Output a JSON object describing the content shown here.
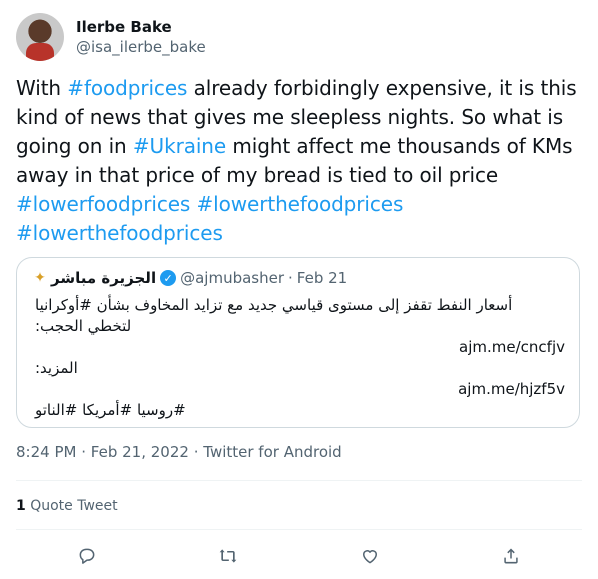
{
  "author": {
    "display_name": "Ilerbe Bake",
    "handle": "@isa_ilerbe_bake"
  },
  "tweet": {
    "segments": [
      {
        "text": "With ",
        "type": "text"
      },
      {
        "text": "#foodprices",
        "type": "hashtag"
      },
      {
        "text": " already forbidingly expensive, it is this kind of news that gives me sleepless nights. So what is going on in ",
        "type": "text"
      },
      {
        "text": "#Ukraine",
        "type": "hashtag"
      },
      {
        "text": " might affect me thousands of KMs away in that price of my bread is tied to oil price ",
        "type": "text"
      },
      {
        "text": "#lowerfoodprices",
        "type": "hashtag"
      },
      {
        "text": " ",
        "type": "text"
      },
      {
        "text": "#lowerthefoodprices",
        "type": "hashtag"
      },
      {
        "text": " ",
        "type": "text"
      },
      {
        "text": "#lowerthefoodprices",
        "type": "hashtag"
      }
    ]
  },
  "quote": {
    "name": "الجزيرة مباشر",
    "handle": "@ajmubasher",
    "separator": "·",
    "date": "Feb 21",
    "lines": [
      "أسعار النفط تقفز إلى مستوى قياسي جديد مع تزايد المخاوف بشأن #أوكرانيا",
      "لتخطي الحجب:",
      "ajm.me/cncfjv",
      "المزيد:",
      "ajm.me/hjzf5v",
      "#روسيا #أمريكا #الناتو"
    ]
  },
  "meta": {
    "time": "8:24 PM",
    "separator": "·",
    "date": "Feb 21, 2022",
    "source": "Twitter for Android"
  },
  "stats": {
    "quote_count": "1",
    "quote_label": "Quote Tweet"
  },
  "actions": [
    "reply-icon",
    "retweet-icon",
    "like-icon",
    "share-icon"
  ]
}
